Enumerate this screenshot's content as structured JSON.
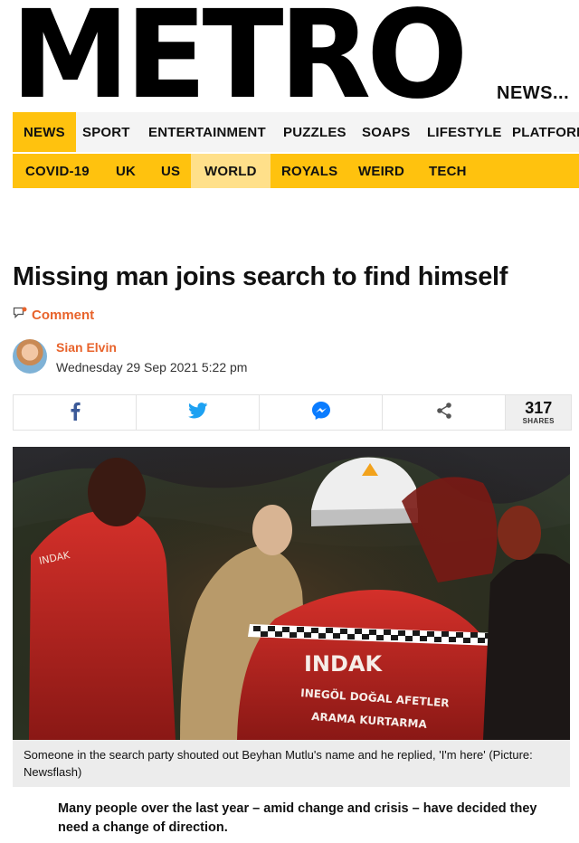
{
  "header": {
    "logo_text": "METRO",
    "tagline": "NEWS..."
  },
  "nav_primary": [
    {
      "label": "NEWS",
      "active": true
    },
    {
      "label": "SPORT",
      "active": false
    },
    {
      "label": "ENTERTAINMENT",
      "active": false
    },
    {
      "label": "PUZZLES",
      "active": false
    },
    {
      "label": "SOAPS",
      "active": false
    },
    {
      "label": "LIFESTYLE",
      "active": false
    },
    {
      "label": "PLATFORM",
      "active": false
    }
  ],
  "nav_secondary": [
    {
      "label": "COVID-19",
      "active": false
    },
    {
      "label": "UK",
      "active": false
    },
    {
      "label": "US",
      "active": false
    },
    {
      "label": "WORLD",
      "active": true
    },
    {
      "label": "ROYALS",
      "active": false
    },
    {
      "label": "WEIRD",
      "active": false
    },
    {
      "label": "TECH",
      "active": false
    }
  ],
  "article": {
    "headline": "Missing man joins search to find himself",
    "comment_label": "Comment",
    "author": "Sian Elvin",
    "date": "Wednesday 29 Sep 2021 5:22 pm",
    "share": {
      "buttons": [
        "facebook-icon",
        "twitter-icon",
        "messenger-icon",
        "share-icon"
      ],
      "count": "317",
      "count_label": "SHARES"
    },
    "image": {
      "jacket_text_line1": "INDAK",
      "jacket_text_line2": "INEGÖL DOĞAL AFETLER",
      "jacket_text_line3": "ARAMA KURTARMA"
    },
    "caption": "Someone in the search party shouted out Beyhan Mutlu's name and he replied, 'I'm here' (Picture: Newsflash)",
    "body_first_paragraph": "Many people over the last year – amid change and crisis – have decided they need a change of direction."
  },
  "colors": {
    "brand_yellow": "#ffc20e",
    "accent_orange": "#e8632b",
    "facebook_blue": "#3b5998",
    "twitter_blue": "#1da1f2",
    "messenger_blue": "#0a7cff"
  }
}
